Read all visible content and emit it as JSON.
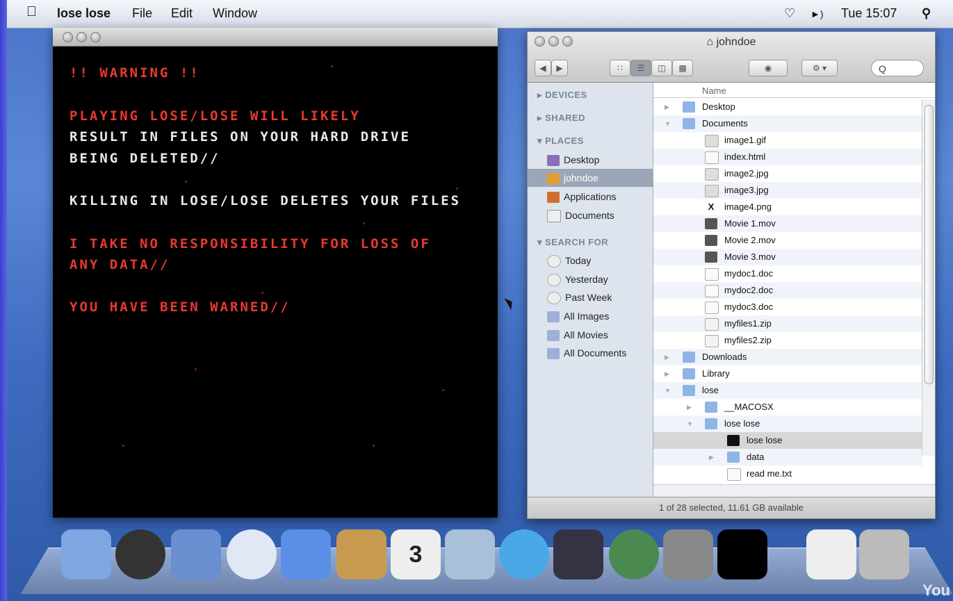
{
  "menubar": {
    "app_name": "lose lose",
    "menus": [
      "File",
      "Edit",
      "Window"
    ],
    "clock": "Tue 15:07"
  },
  "game_window": {
    "lines": [
      {
        "text": "!! WARNING !!",
        "color": "red"
      },
      {
        "text": "PLAYING LOSE/LOSE WILL LIKELY",
        "color": "red"
      },
      {
        "text": "RESULT IN FILES ON YOUR HARD DRIVE",
        "color": "white"
      },
      {
        "text": "BEING DELETED//",
        "color": "white"
      },
      {
        "text": "KILLING IN LOSE/LOSE DELETES YOUR FILES",
        "color": "white"
      },
      {
        "text": "I TAKE NO RESPONSIBILITY FOR LOSS OF",
        "color": "red"
      },
      {
        "text": "ANY DATA//",
        "color": "red"
      },
      {
        "text": "YOU HAVE BEEN WARNED//",
        "color": "red"
      }
    ]
  },
  "finder": {
    "title": "johndoe",
    "search_placeholder": "Q",
    "sidebar": {
      "devices": "DEVICES",
      "shared": "SHARED",
      "places": "PLACES",
      "places_items": [
        "Desktop",
        "johndoe",
        "Applications",
        "Documents"
      ],
      "search_for": "SEARCH FOR",
      "search_items": [
        "Today",
        "Yesterday",
        "Past Week",
        "All Images",
        "All Movies",
        "All Documents"
      ]
    },
    "column_header": "Name",
    "files": [
      {
        "name": "Desktop",
        "type": "folder",
        "level": 0,
        "tri": "right"
      },
      {
        "name": "Documents",
        "type": "folder",
        "level": 0,
        "tri": "down"
      },
      {
        "name": "image1.gif",
        "type": "image",
        "level": 1
      },
      {
        "name": "index.html",
        "type": "doc",
        "level": 1
      },
      {
        "name": "image2.jpg",
        "type": "image",
        "level": 1
      },
      {
        "name": "image3.jpg",
        "type": "image",
        "level": 1
      },
      {
        "name": "image4.png",
        "type": "x",
        "level": 1
      },
      {
        "name": "Movie 1.mov",
        "type": "movie",
        "level": 1
      },
      {
        "name": "Movie 2.mov",
        "type": "movie",
        "level": 1
      },
      {
        "name": "Movie 3.mov",
        "type": "movie",
        "level": 1
      },
      {
        "name": "mydoc1.doc",
        "type": "doc",
        "level": 1
      },
      {
        "name": "mydoc2.doc",
        "type": "doc",
        "level": 1
      },
      {
        "name": "mydoc3.doc",
        "type": "doc",
        "level": 1
      },
      {
        "name": "myfiles1.zip",
        "type": "zip",
        "level": 1
      },
      {
        "name": "myfiles2.zip",
        "type": "zip",
        "level": 1
      },
      {
        "name": "Downloads",
        "type": "folder",
        "level": 0,
        "tri": "right"
      },
      {
        "name": "Library",
        "type": "folder",
        "level": 0,
        "tri": "right"
      },
      {
        "name": "lose",
        "type": "folder",
        "level": 0,
        "tri": "down"
      },
      {
        "name": "__MACOSX",
        "type": "folder",
        "level": 1,
        "tri": "right"
      },
      {
        "name": "lose lose",
        "type": "folder",
        "level": 1,
        "tri": "down"
      },
      {
        "name": "lose lose",
        "type": "app",
        "level": 2,
        "selected": true
      },
      {
        "name": "data",
        "type": "folder",
        "level": 2,
        "tri": "right"
      },
      {
        "name": "read me.txt",
        "type": "doc",
        "level": 2
      }
    ],
    "status": "1 of 28 selected, 11.61 GB available"
  },
  "dock": {
    "items": [
      "finder-icon",
      "dashboard-icon",
      "mail-icon",
      "safari-icon",
      "ichat-icon",
      "address-book-icon",
      "ical-icon",
      "iphoto-icon",
      "itunes-icon",
      "spaces-icon",
      "time-machine-icon",
      "system-preferences-icon",
      "lose-lose-icon",
      "zip-file-icon",
      "trash-icon"
    ],
    "ical_day": "3"
  },
  "watermark": "You"
}
